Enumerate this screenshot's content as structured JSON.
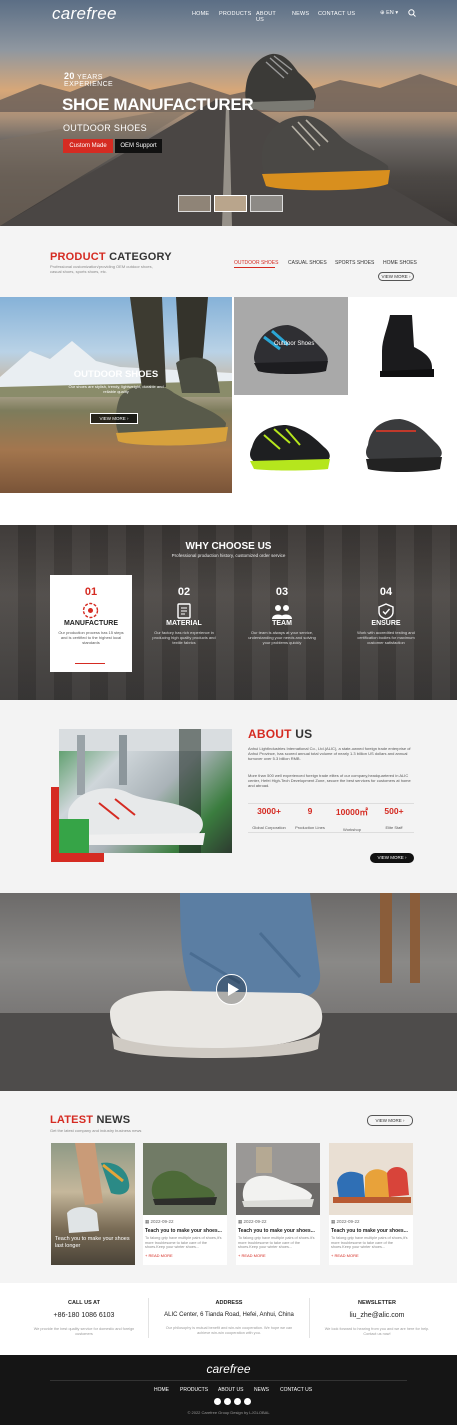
{
  "brand": {
    "logo": "carefree"
  },
  "nav": {
    "items": [
      "HOME",
      "PRODUCTS",
      "ABOUT US",
      "NEWS",
      "CONTACT US"
    ],
    "lang": "EN"
  },
  "hero": {
    "years": "20",
    "years_word": "YEARS",
    "experience": "EXPERIENCE",
    "title": "SHOE MANUFACTURER",
    "subtitle": "OUTDOOR SHOES",
    "btn_custom": "Custom Made",
    "btn_oem": "OEM Support"
  },
  "category": {
    "title_red": "PRODUCT",
    "title_dark": "CATEGORY",
    "desc": "Professional customization/providing OEM outdoor shoes, casual shoes, sports shoes, etc.",
    "tabs": [
      "OUTDOOR SHOES",
      "CASUAL SHOES",
      "SPORTS SHOES",
      "HOME SHOES"
    ],
    "view_more": "VIEW MORE",
    "feature_title": "OUTDOOR SHOES",
    "feature_desc": "Our shoes are stylish, trendy, lightweight, durable and reliable quality",
    "feature_btn": "VIEW MORE",
    "hover_label": "Outdoor Shoes"
  },
  "why": {
    "title": "WHY CHOOSE US",
    "subtitle": "Professional production history, customized order service",
    "cards": [
      {
        "num": "01",
        "title": "MANUFACTURE",
        "desc": "Our production process has 15 steps and is certified to the highest local standards"
      },
      {
        "num": "02",
        "title": "MATERIAL",
        "desc": "Our factory has rich experience in producing high quality products and textile fabrics"
      },
      {
        "num": "03",
        "title": "TEAM",
        "desc": "Our team is always at your service, understanding your needs and solving your problems quickly"
      },
      {
        "num": "04",
        "title": "ENSURE",
        "desc": "Work with accredited testing and certification bodies for maximum customer satisfaction"
      }
    ]
  },
  "about": {
    "title_red": "ABOUT",
    "title_dark": "US",
    "p1": "Anhui LightIndustries International Co., Ltd.(ALIC), a state-owned foreign trade enterprise of Anhui Province, has scored annual total volume of nearly 1.3 billion US dollars and annual turnover over 5.3 billion RMB.",
    "p2": "More than 500 well experienced foreign trade elites of our company,headquartered in ALIC center, Hefei High-Tech Development Zone, secure the best services for customers at home and abroad.",
    "stats": [
      {
        "value": "3000+",
        "label": "Global Corporation"
      },
      {
        "value": "9",
        "label": "Production Lines"
      },
      {
        "value": "10000㎡",
        "label": "Workshop"
      },
      {
        "value": "500+",
        "label": "Elite Staff"
      }
    ],
    "btn": "VIEW MORE"
  },
  "news": {
    "title_red": "LATEST",
    "title_dark": "NEWS",
    "desc": "Get the latest company and industry business news",
    "view_more": "VIEW MORE",
    "first_caption": "Teach you to make your shoes last longer",
    "items": [
      {
        "date": "2022-09-22",
        "title": "Teach you to make your shoes...",
        "desc": "To falong grip have multiple pairs of shoes,it's more troublesome to take care of the shoes.Keep your winter shoes...",
        "more": "+ READ MORE"
      },
      {
        "date": "2022-09-22",
        "title": "Teach you to make your shoes...",
        "desc": "To falong grip have multiple pairs of shoes.it's more troublesome to take care of the shoes.Keep your winter shoes...",
        "more": "+ READ MORE"
      },
      {
        "date": "2022-09-22",
        "title": "Teach you to make your shoes...",
        "desc": "To falong grip have multiple pairs of shoes,it's more troublesome to take care of the shoes.Keep your winter shoes...",
        "more": "+ READ MORE"
      }
    ]
  },
  "contact": [
    {
      "label": "CALL US AT",
      "value": "+86-180 1086 6103",
      "desc": "We provide the best quality service for domestic and foreign customers"
    },
    {
      "label": "ADDRESS",
      "value": "ALIC Center, 6 Tianda Road, Hefei, Anhui, China",
      "desc": "Our philosophy is mutual benefit and win-win cooperation. We hope we can achieve win-win cooperation with you."
    },
    {
      "label": "NEWSLETTER",
      "value": "liu_zhe@alic.com",
      "desc": "We look forward to hearing from you and we are here for help. Contact us now!"
    }
  ],
  "footer": {
    "logo": "carefree",
    "nav": [
      "HOME",
      "PRODUCTS",
      "ABOUT US",
      "NEWS",
      "CONTACT US"
    ],
    "copyright": "© 2022 Carefree Group Design by LJGLOBAL"
  },
  "colors": {
    "accent": "#d52b22",
    "dark": "#151515"
  }
}
